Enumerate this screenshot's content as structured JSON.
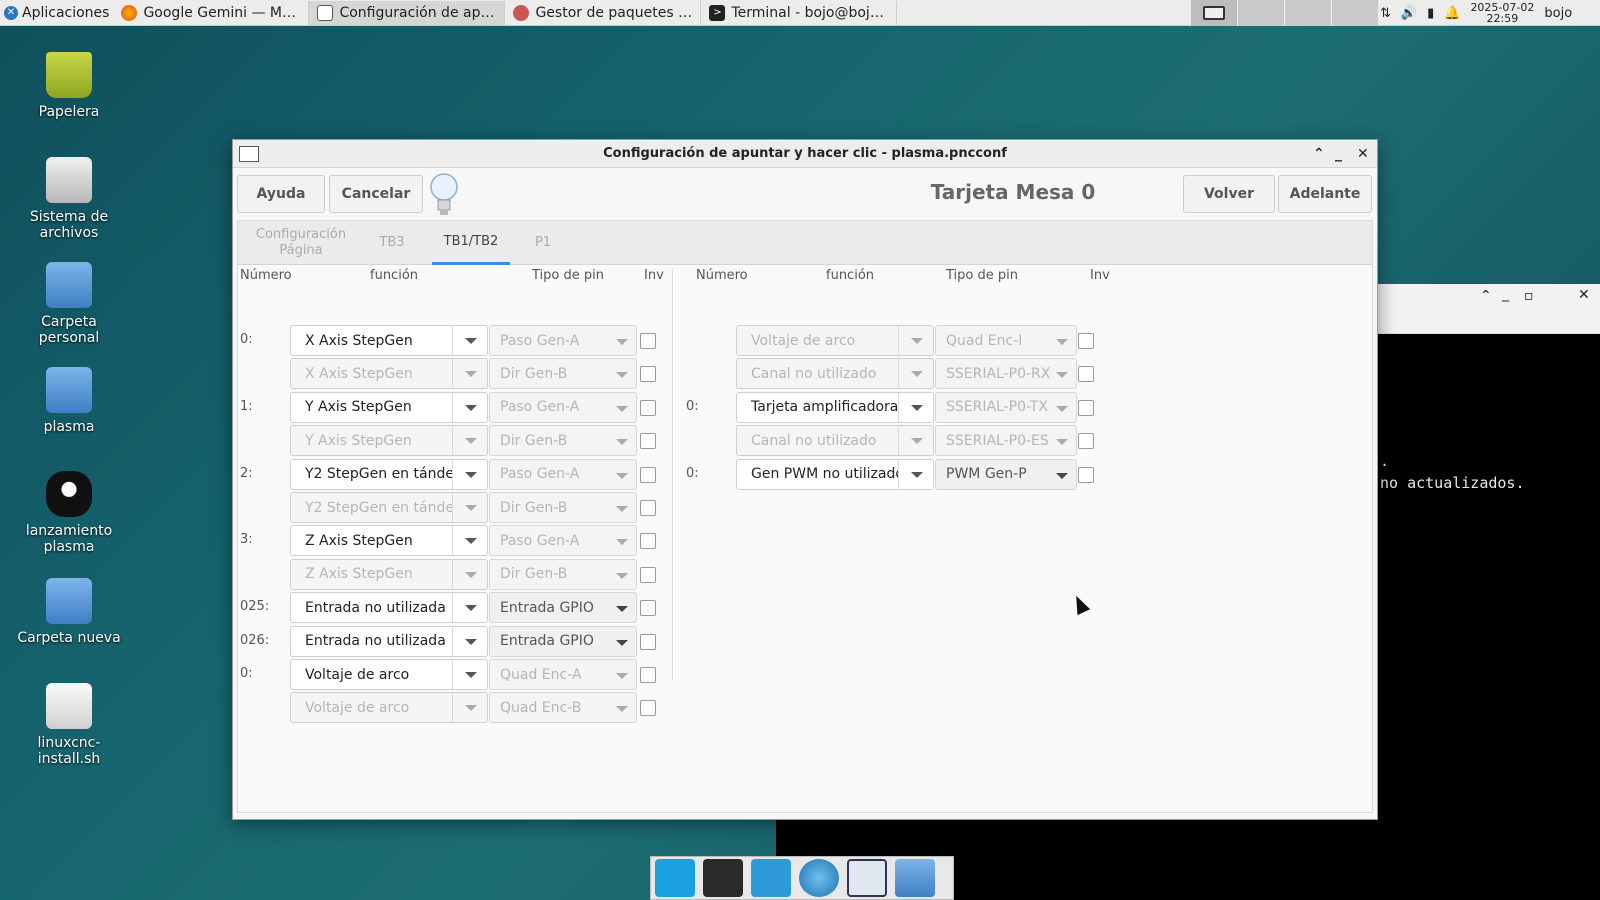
{
  "panel": {
    "app_menu": "Aplicaciones",
    "tasks": [
      {
        "label": "Google Gemini — Mozill..."
      },
      {
        "label": "Configuración de apunt..."
      },
      {
        "label": "Gestor de paquetes Syn..."
      },
      {
        "label": "Terminal - bojo@bojo: ~"
      }
    ],
    "date": "2025-07-02",
    "time": "22:59",
    "user": "bojo"
  },
  "desktop": {
    "icons": [
      {
        "label": "Papelera"
      },
      {
        "label": "Sistema de archivos"
      },
      {
        "label": "Carpeta personal"
      },
      {
        "label": "plasma"
      },
      {
        "label": "lanzamiento plasma"
      },
      {
        "label": "Carpeta nueva"
      },
      {
        "label": "linuxcnc-install.sh"
      }
    ]
  },
  "terminal": {
    "line1": ".",
    "line2": "no actualizados."
  },
  "dialog": {
    "title": "Configuración de apuntar y hacer clic - plasma.pncconf",
    "help_btn": "Ayuda",
    "cancel_btn": "Cancelar",
    "page_title": "Tarjeta Mesa 0",
    "back_btn": "Volver",
    "next_btn": "Adelante",
    "tabs": [
      "Configuración Página",
      "TB3",
      "TB1/TB2",
      "P1"
    ],
    "active_tab": "TB1/TB2",
    "headers": {
      "numero": "Número",
      "funcion": "función",
      "tipo": "Tipo de pin",
      "inv": "Inv"
    },
    "left_rows": [
      {
        "num": "0:",
        "func": "X Axis StepGen",
        "type": "Paso Gen-A",
        "enabled": true,
        "type_enabled": false
      },
      {
        "num": "",
        "func": "X Axis StepGen",
        "type": "Dir Gen-B",
        "enabled": false,
        "type_enabled": false
      },
      {
        "num": "1:",
        "func": "Y Axis StepGen",
        "type": "Paso Gen-A",
        "enabled": true,
        "type_enabled": false
      },
      {
        "num": "",
        "func": "Y Axis StepGen",
        "type": "Dir Gen-B",
        "enabled": false,
        "type_enabled": false
      },
      {
        "num": "2:",
        "func": "Y2 StepGen en tánde",
        "type": "Paso Gen-A",
        "enabled": true,
        "type_enabled": false
      },
      {
        "num": "",
        "func": "Y2 StepGen en tánde",
        "type": "Dir Gen-B",
        "enabled": false,
        "type_enabled": false
      },
      {
        "num": "3:",
        "func": "Z Axis StepGen",
        "type": "Paso Gen-A",
        "enabled": true,
        "type_enabled": false
      },
      {
        "num": "",
        "func": "Z Axis StepGen",
        "type": "Dir Gen-B",
        "enabled": false,
        "type_enabled": false
      },
      {
        "num": "025:",
        "func": "Entrada no utilizada",
        "type": "Entrada GPIO",
        "enabled": true,
        "type_enabled": true
      },
      {
        "num": "026:",
        "func": "Entrada no utilizada",
        "type": "Entrada GPIO",
        "enabled": true,
        "type_enabled": true
      },
      {
        "num": "0:",
        "func": "Voltaje de arco",
        "type": "Quad Enc-A",
        "enabled": true,
        "type_enabled": false
      },
      {
        "num": "",
        "func": "Voltaje de arco",
        "type": "Quad Enc-B",
        "enabled": false,
        "type_enabled": false
      }
    ],
    "right_rows": [
      {
        "num": "",
        "func": "Voltaje de arco",
        "type": "Quad Enc-I",
        "enabled": false,
        "type_enabled": false
      },
      {
        "num": "",
        "func": "Canal no utilizado",
        "type": "SSERIAL-P0-RX",
        "enabled": false,
        "type_enabled": false
      },
      {
        "num": "0:",
        "func": "Tarjeta amplificadora",
        "type": "SSERIAL-P0-TX",
        "enabled": true,
        "type_enabled": false
      },
      {
        "num": "",
        "func": "Canal no utilizado",
        "type": "SSERIAL-P0-ES",
        "enabled": false,
        "type_enabled": false
      },
      {
        "num": "0:",
        "func": "Gen PWM no utilizado",
        "type": "PWM Gen-P",
        "enabled": true,
        "type_enabled": true
      }
    ]
  }
}
